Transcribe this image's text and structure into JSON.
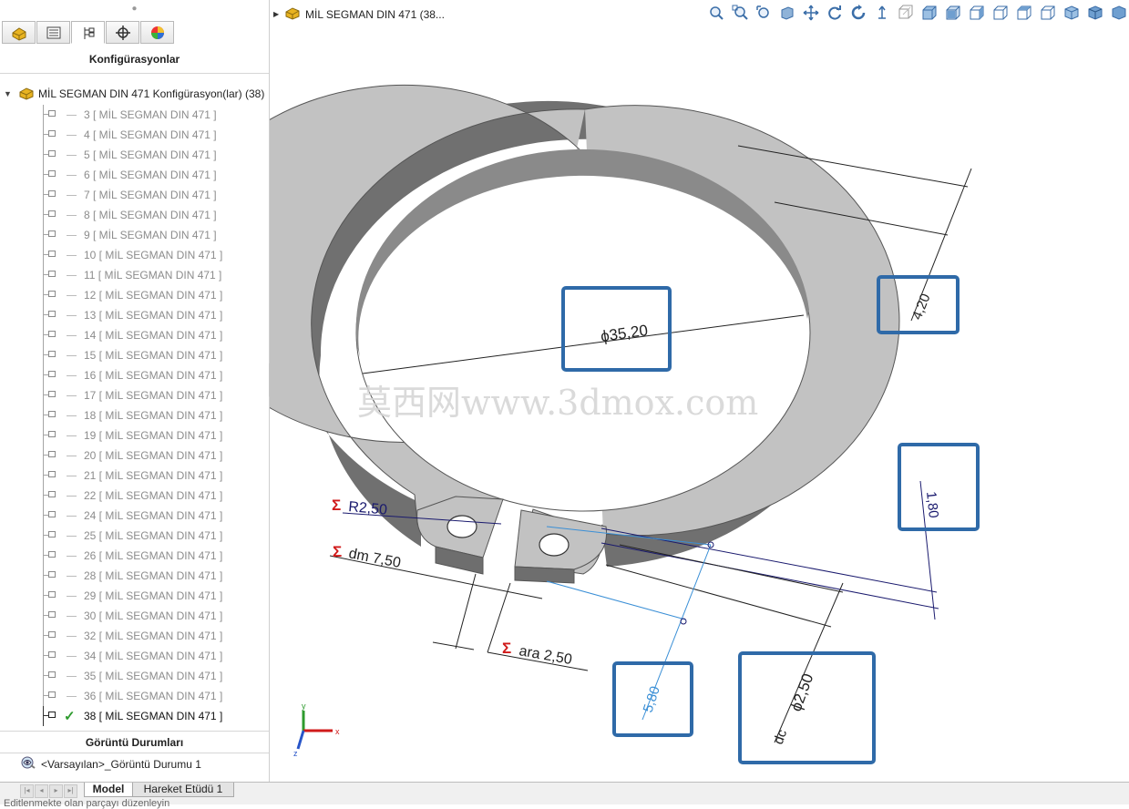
{
  "panel": {
    "title": "Konfigürasyonlar",
    "root_label": "MİL SEGMAN DIN 471 Konfigürasyon(lar)  (38)",
    "configs": [
      {
        "label": "3 [ MİL SEGMAN DIN 471 ]",
        "active": false
      },
      {
        "label": "4 [ MİL SEGMAN DIN 471 ]",
        "active": false
      },
      {
        "label": "5 [ MİL SEGMAN DIN 471 ]",
        "active": false
      },
      {
        "label": "6 [ MİL SEGMAN DIN 471 ]",
        "active": false
      },
      {
        "label": "7 [ MİL SEGMAN DIN 471 ]",
        "active": false
      },
      {
        "label": "8 [ MİL SEGMAN DIN 471 ]",
        "active": false
      },
      {
        "label": "9 [ MİL SEGMAN DIN 471 ]",
        "active": false
      },
      {
        "label": "10 [ MİL SEGMAN DIN 471 ]",
        "active": false
      },
      {
        "label": "11 [ MİL SEGMAN DIN 471 ]",
        "active": false
      },
      {
        "label": "12 [ MİL SEGMAN DIN 471 ]",
        "active": false
      },
      {
        "label": "13 [ MİL SEGMAN DIN 471 ]",
        "active": false
      },
      {
        "label": "14 [ MİL SEGMAN DIN 471 ]",
        "active": false
      },
      {
        "label": "15 [ MİL SEGMAN DIN 471 ]",
        "active": false
      },
      {
        "label": "16 [ MİL SEGMAN DIN 471 ]",
        "active": false
      },
      {
        "label": "17 [ MİL SEGMAN DIN 471 ]",
        "active": false
      },
      {
        "label": "18 [ MİL SEGMAN DIN 471 ]",
        "active": false
      },
      {
        "label": "19 [ MİL SEGMAN DIN 471 ]",
        "active": false
      },
      {
        "label": "20 [ MİL SEGMAN DIN 471 ]",
        "active": false
      },
      {
        "label": "21 [ MİL SEGMAN DIN 471 ]",
        "active": false
      },
      {
        "label": "22 [ MİL SEGMAN DIN 471 ]",
        "active": false
      },
      {
        "label": "24 [ MİL SEGMAN DIN 471 ]",
        "active": false
      },
      {
        "label": "25 [ MİL SEGMAN DIN 471 ]",
        "active": false
      },
      {
        "label": "26 [ MİL SEGMAN DIN 471 ]",
        "active": false
      },
      {
        "label": "28 [ MİL SEGMAN DIN 471 ]",
        "active": false
      },
      {
        "label": "29 [ MİL SEGMAN DIN 471 ]",
        "active": false
      },
      {
        "label": "30 [ MİL SEGMAN DIN 471 ]",
        "active": false
      },
      {
        "label": "32 [ MİL SEGMAN DIN 471 ]",
        "active": false
      },
      {
        "label": "34 [ MİL SEGMAN DIN 471 ]",
        "active": false
      },
      {
        "label": "35 [ MİL SEGMAN DIN 471 ]",
        "active": false
      },
      {
        "label": "36 [ MİL SEGMAN DIN 471 ]",
        "active": false
      },
      {
        "label": "38 [ MİL SEGMAN DIN 471 ]",
        "active": true
      }
    ],
    "display_states_title": "Görüntü Durumları",
    "display_state": "<Varsayılan>_Görüntü Durumu 1"
  },
  "document": {
    "title": "MİL SEGMAN DIN 471  (38..."
  },
  "viewport": {
    "dimensions": {
      "diameter": "ϕ35,20",
      "thickness": "4,20",
      "width": "1,80",
      "radius_sigma": "Σ",
      "radius": "R2,50",
      "dm_sigma": "Σ",
      "dm": "dm  7,50",
      "ara_sigma": "Σ",
      "ara": "ara  2,50",
      "hole_offset": "5,80",
      "hole_diameter": "ϕ2,50",
      "hole_diameter_prefix": "dc"
    },
    "watermark": "莫西网www.3dmox.com",
    "triad": {
      "x": "x",
      "y": "y",
      "z": "z"
    }
  },
  "bottom": {
    "tabs": [
      "Model",
      "Hareket Etüdü 1"
    ],
    "active_tab": "Model",
    "status": "Editlenmekte olan parçayı düzenleyin"
  },
  "colors": {
    "accent_box": "#2f6aa8",
    "dim_dark": "#1a1a6e",
    "dim_light": "#3a8fd6",
    "sigma": "#d01a1a",
    "part_face": "#bdbdbd",
    "part_side": "#6e6e6e"
  }
}
